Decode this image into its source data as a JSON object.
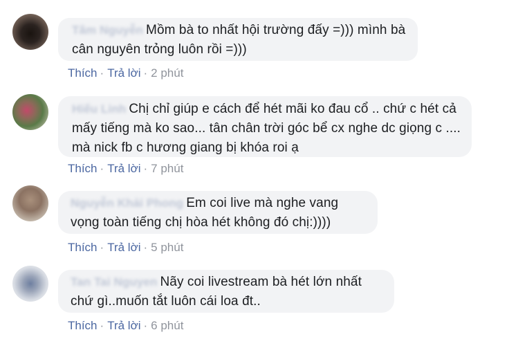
{
  "comments": [
    {
      "author": "Tâm Nguyễn",
      "text": "Mồm bà to nhất hội trường đấy =))) mình bà cân nguyên trỏng luôn rồi =)))",
      "like": "Thích",
      "reply": "Trả lời",
      "time": "2 phút"
    },
    {
      "author": "Hiếu Linh",
      "text": "Chị chỉ giúp e cách để hét mãi ko đau cổ .. chứ c hét cả mấy tiếng mà ko sao... tân chân trời góc bể cx nghe dc giọng c .... mà nick fb c hương giang bị khóa roi ạ",
      "like": "Thích",
      "reply": "Trả lời",
      "time": "7 phút"
    },
    {
      "author": "Nguyễn Khải Phong",
      "text": "Em coi live mà nghe vang vọng toàn tiếng chị hòa hét không đó chị:))))",
      "like": "Thích",
      "reply": "Trả lời",
      "time": "5 phút"
    },
    {
      "author": "Tan Tai Nguyen",
      "text": "Nãy coi livestream bà hét lớn nhất chứ gì..muốn tắt luôn cái loa đt..",
      "like": "Thích",
      "reply": "Trả lời",
      "time": "6 phút"
    }
  ]
}
